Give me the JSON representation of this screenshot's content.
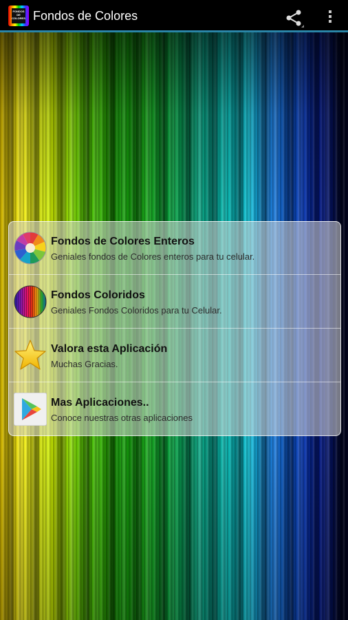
{
  "app": {
    "title": "Fondos de Colores",
    "icon_text": [
      "FONDOS",
      "DE",
      "COLORES"
    ]
  },
  "actions": {
    "share_icon": "share-icon",
    "overflow_icon": "overflow-menu-icon"
  },
  "menu": {
    "items": [
      {
        "title": "Fondos de Colores Enteros",
        "subtitle": "Geniales fondos de Colores enteros para tu celular.",
        "icon": "color-wheel-icon"
      },
      {
        "title": "Fondos Coloridos",
        "subtitle": "Geniales Fondos Coloridos para tu Celular.",
        "icon": "color-stripes-icon"
      },
      {
        "title": "Valora esta Aplicación",
        "subtitle": "Muchas Gracias.",
        "icon": "star-icon"
      },
      {
        "title": "Mas Aplicaciones..",
        "subtitle": "Conoce nuestras otras aplicaciones",
        "icon": "play-store-icon"
      }
    ]
  },
  "colors": {
    "accent": "#2a86a8",
    "actionbar": "#000000"
  }
}
